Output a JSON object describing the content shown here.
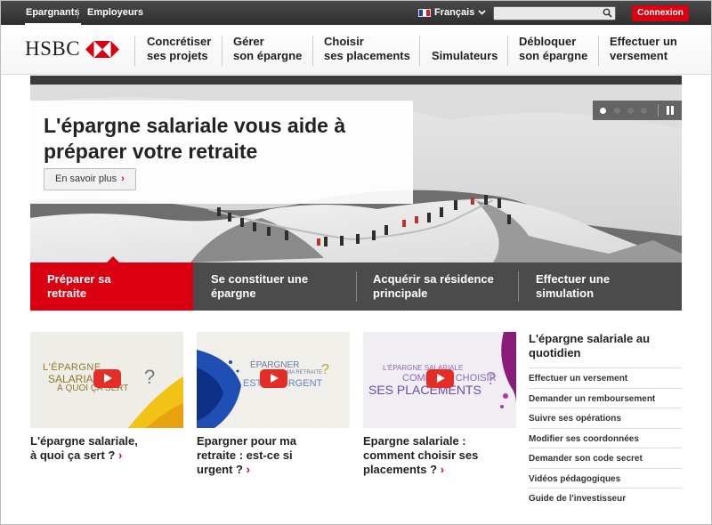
{
  "topbar": {
    "tabs": [
      "Epargnants",
      "Employeurs"
    ],
    "language": "Français",
    "search_placeholder": "",
    "login": "Connexion"
  },
  "header": {
    "logo_text": "HSBC",
    "nav": [
      {
        "l1": "Concrétiser",
        "l2": "ses projets"
      },
      {
        "l1": "Gérer",
        "l2": "son épargne"
      },
      {
        "l1": "Choisir",
        "l2": "ses placements"
      },
      {
        "l1": "",
        "l2": "Simulateurs"
      },
      {
        "l1": "Débloquer",
        "l2": "son épargne"
      },
      {
        "l1": "Effectuer un",
        "l2": "versement"
      }
    ]
  },
  "hero": {
    "title_l1": "L'épargne salariale vous aide à",
    "title_l2": "préparer votre retraite",
    "button": "En savoir plus",
    "slides_total": 4,
    "slide_active": 1
  },
  "hero_tabs": [
    {
      "l1": "Préparer sa",
      "l2": "retraite"
    },
    {
      "l1": "Se constituer une",
      "l2": "épargne"
    },
    {
      "l1": "Acquérir sa résidence",
      "l2": "principale"
    },
    {
      "l1": "Effectuer une",
      "l2": "simulation"
    }
  ],
  "videos": [
    {
      "thumb_l1": "L'ÉPARGNE",
      "thumb_l2": "SALARIALE",
      "thumb_l3": "À QUOI ÇA SERT",
      "cap_l1": "L'épargne salariale,",
      "cap_l2": "à quoi ça sert ?",
      "cap_l3": ""
    },
    {
      "thumb_l1": "ÉPARGNER",
      "thumb_l2": "POUR MA RETRAITE",
      "thumb_l3": "EST-CE URGENT",
      "cap_l1": "Epargner pour ma",
      "cap_l2": "retraite : est-ce si",
      "cap_l3": "urgent ?"
    },
    {
      "thumb_l1": "L'ÉPARGNE SALARIALE",
      "thumb_l2": "COMMENT CHOISIR",
      "thumb_l3": "SES PLACEMENTS",
      "cap_l1": "Epargne salariale :",
      "cap_l2": "comment choisir ses",
      "cap_l3": "placements ?"
    }
  ],
  "side": {
    "title_l1": "L'épargne salariale au",
    "title_l2": "quotidien",
    "links": [
      "Effectuer un versement",
      "Demander un remboursement",
      "Suivre ses opérations",
      "Modifier ses coordonnées",
      "Demander son code secret",
      "Vidéos pédagogiques",
      "Guide de l'investisseur"
    ]
  },
  "colors": {
    "brand_red": "#db0011",
    "dark_bar": "#3a3a3a",
    "tab_bar": "#4b4b4b"
  }
}
